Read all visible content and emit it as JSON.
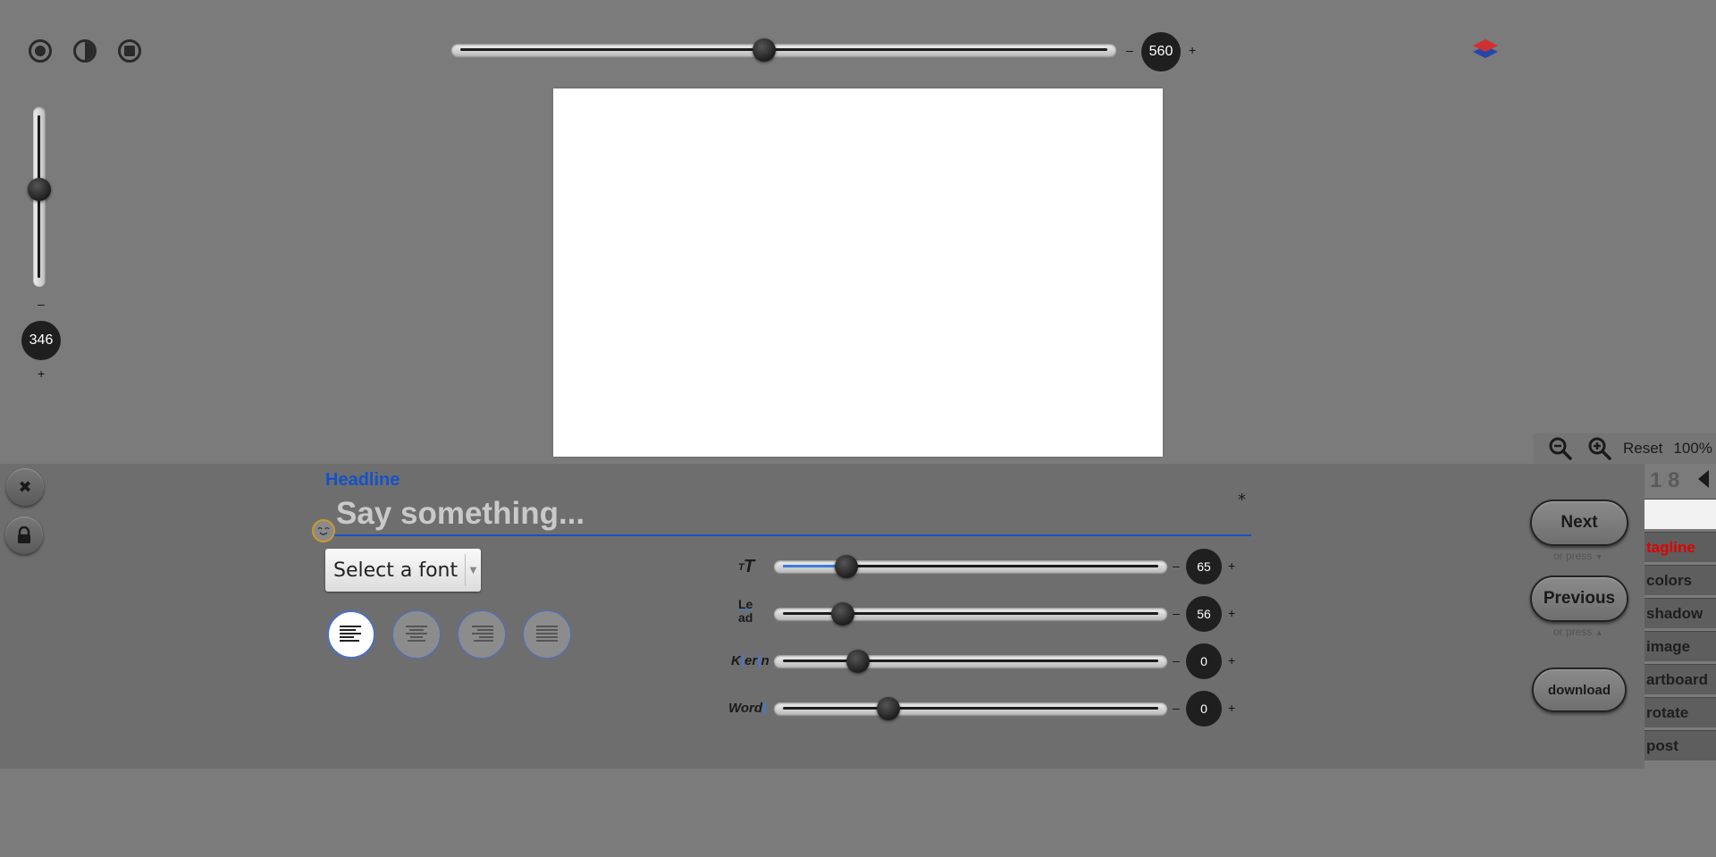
{
  "top_bar": {
    "mode_icons": [
      "record-icon",
      "contrast-icon",
      "stop-icon"
    ],
    "width_slider": {
      "value": "560",
      "minus": "–",
      "plus": "+",
      "fraction": 0.48
    }
  },
  "left_bar": {
    "height_slider": {
      "value": "346",
      "minus": "–",
      "plus": "+",
      "fraction": 0.47
    }
  },
  "zoom": {
    "reset_label": "Reset",
    "level": "100%"
  },
  "pager": {
    "current": "1",
    "sep": "/",
    "total": "8"
  },
  "panel": {
    "close_icon": "✖",
    "lock_icon": "lock-icon",
    "section_label": "Headline",
    "headline_placeholder": "Say something...",
    "asterisk": "*",
    "font_select": {
      "selected": "Select a font"
    },
    "alignments": [
      "align-left",
      "align-center",
      "align-right",
      "align-justify"
    ],
    "controls": [
      {
        "label": "TT",
        "value": "65",
        "fraction": 0.17
      },
      {
        "label": "Lead",
        "value": "56",
        "fraction": 0.16
      },
      {
        "label": "Kern",
        "value": "0",
        "fraction": 0.2
      },
      {
        "label": "Word",
        "value": "0",
        "fraction": 0.28
      }
    ],
    "minus": "–",
    "plus": "+"
  },
  "nav": {
    "next_label": "Next",
    "next_hint": "or press",
    "previous_label": "Previous",
    "previous_hint": "or press",
    "download_label": "download"
  },
  "side_tabs": [
    "",
    "tagline",
    "colors",
    "shadow",
    "image",
    "artboard",
    "rotate",
    "post"
  ],
  "colors": {
    "accent": "#1552c9",
    "active_tab": "#e00000",
    "panel": "#6e6e6e",
    "background": "#7b7b7b"
  }
}
